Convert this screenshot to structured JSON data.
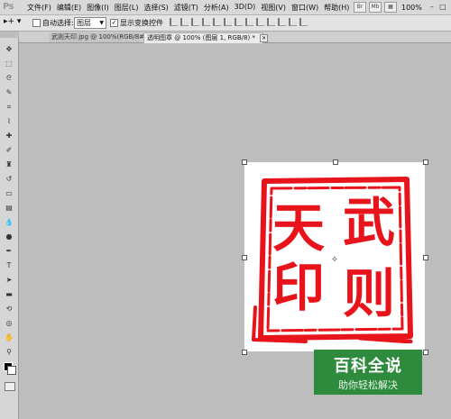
{
  "app": {
    "logo": "Ps"
  },
  "menubar": {
    "items": [
      "文件(F)",
      "编辑(E)",
      "图像(I)",
      "图层(L)",
      "选择(S)",
      "滤镜(T)",
      "分析(A)",
      "3D(D)",
      "视图(V)",
      "窗口(W)",
      "帮助(H)"
    ],
    "btn_br": "Br",
    "btn_mb": "Mb",
    "zoom": "100%"
  },
  "options": {
    "auto_select_label": "自动选择:",
    "auto_select_value": "图层",
    "show_transform_label": "显示变换控件"
  },
  "tabs": [
    {
      "label": "武则天印.jpg @ 100%(RGB/8#)"
    },
    {
      "label": "透明图章 @ 100% (图层 1, RGB/8) *"
    }
  ],
  "seal": {
    "chars": [
      "天",
      "武",
      "印",
      "则"
    ],
    "color": "#e8141b"
  },
  "watermark": {
    "title": "百科全说",
    "subtitle": "助你轻松解决",
    "bg": "#2e8b3d"
  }
}
